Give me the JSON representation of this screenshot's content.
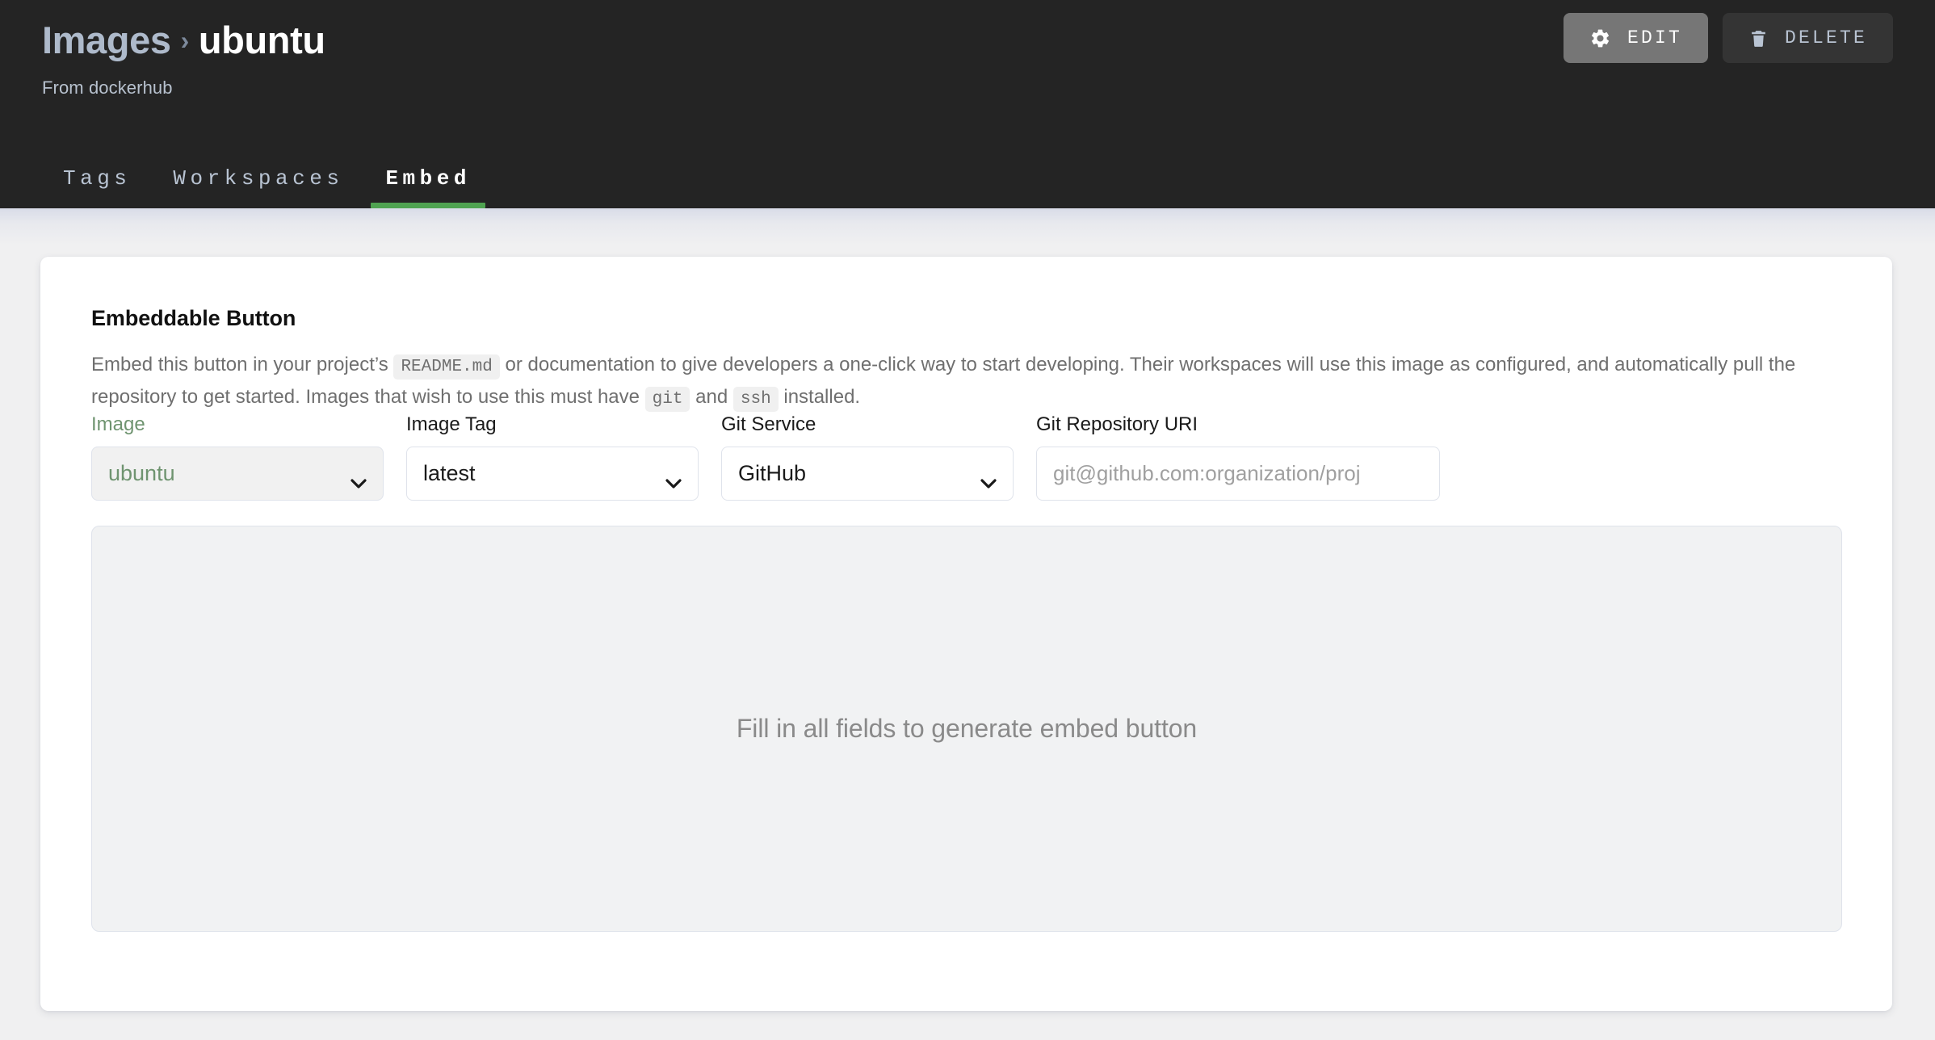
{
  "header": {
    "breadcrumb_parent": "Images",
    "breadcrumb_separator": "›",
    "breadcrumb_current": "ubuntu",
    "subtitle": "From dockerhub",
    "edit_label": "EDIT",
    "delete_label": "DELETE",
    "edit_bg": "#767676",
    "delete_bg": "#343434",
    "bar_bg": "#242424"
  },
  "tabs": [
    {
      "label": "Tags",
      "active": false
    },
    {
      "label": "Workspaces",
      "active": false
    },
    {
      "label": "Embed",
      "active": true
    }
  ],
  "tab_accent": "#4fa351",
  "card": {
    "title": "Embeddable Button",
    "desc_part1": "Embed this button in your project’s",
    "desc_code1": "README.md",
    "desc_part2": "or documentation to give developers a one-click way to start developing. Their workspaces will use this image as configured, and automatically pull the repository to get started. Images that wish to use this must have",
    "desc_code2": "git",
    "desc_part3": "and",
    "desc_code3": "ssh",
    "desc_part4": "installed."
  },
  "form": {
    "image": {
      "label": "Image",
      "value": "ubuntu",
      "disabled": true,
      "label_color": "#6f9470",
      "value_color": "#6f9470"
    },
    "image_tag": {
      "label": "Image Tag",
      "value": "latest",
      "disabled": false
    },
    "git_service": {
      "label": "Git Service",
      "value": "GitHub",
      "disabled": false
    },
    "git_repository_uri": {
      "label": "Git Repository URI",
      "value": "",
      "placeholder": "git@github.com:organization/proj"
    }
  },
  "preview": {
    "empty_text": "Fill in all fields to generate embed button"
  }
}
